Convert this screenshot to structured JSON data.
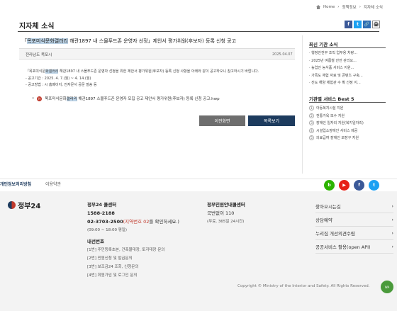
{
  "breadcrumb": [
    "Home",
    "정책정보",
    "지자체 소식"
  ],
  "page_title": "지자체 소식",
  "share_icons": [
    "f",
    "t",
    "🔗",
    "🖨"
  ],
  "post": {
    "title_pre": "「",
    "title_hl1": "목포미식문화갤러리",
    "title_mid": " 해관1897 내 스몰푸드존 운영자 선정」제안서 평가위원(후보자) 등록 신청 공고",
    "author": "전라남도 목포시",
    "date": "2025.04.07",
    "body_line1_pre": "「목포미식문",
    "body_line1_hl": "화갤러리",
    "body_line1_post": " 해관1897 내 스몰푸드존 운영자 선정을 위한 제안서 평가위원(후보자) 등록 신청 사항을 아래와 같이 공고하오니 참고하시기 바랍니다.",
    "body_line2": "- 공고기간 : 2025. 4. 7.(월) ~ 4. 14.(월)",
    "body_line3": "- 공고방법 : 시 홈페이지, 전자문서 공문 발송 등",
    "attachment_pre": "목포미식문화",
    "attachment_hl": "갤러리",
    "attachment_post": " 해관1897 스몰푸드존 운영자 모집 공고 제안서 평가위원(후보자) 등록 신청 공고.hwp"
  },
  "buttons": {
    "prev": "이전화면",
    "list": "목록보기"
  },
  "sidebar": {
    "latest_title": "최신 기관 소식",
    "latest": [
      "· 행정안전부 조직 업무용 차량...",
      "· 2025년 여름철 안전 관리요...",
      "· 농업인 농식품 서비스 지원...",
      "· 가족도 체험 자료 및 콘텐츠 구축...",
      "· 진도 해양 체험관 수 확 선정 지..."
    ],
    "best_title": "기관별 서비스 Best 5",
    "best": [
      "아동복지시설 지원",
      "전통가옥 보수 지원",
      "장애인 일자리 지원(복지일자리)",
      "시설입소장애인 서비스 제공",
      "의료급여 장애인 보장구 지원"
    ]
  },
  "footer": {
    "policy": "개인정보처리방침",
    "terms": "이용약관",
    "sns": [
      {
        "label": "b",
        "color": "#2db400"
      },
      {
        "label": "▶",
        "color": "#e62117"
      },
      {
        "label": "f",
        "color": "#3b5998"
      },
      {
        "label": "t",
        "color": "#1da1f2"
      }
    ],
    "logo_text": "정부24",
    "col1": {
      "title": "정부24 콜센터",
      "phone1": "1588-2188",
      "phone2_pre": "02-3703-2500",
      "phone2_red": "(지역번호 02",
      "phone2_post": "를 확인하세요.)",
      "hours": "(09:00 ~ 18:00 평일)",
      "ext_title": "내선번호",
      "ext1": "[1번] 주민등록초본, 건축물대장, 토지대장 문의",
      "ext2": "[2번] 민원신청 및 발급문의",
      "ext3": "[3번] 보조금24 조회, 신청문의",
      "ext4": "[4번] 회원가입 및 로그인 문의"
    },
    "col2": {
      "title": "정부민원안내콜센터",
      "line1": "국번없이 110",
      "line2": "(무료, 365일 24시간)"
    },
    "links": [
      "찾아오시는길",
      "상담예약",
      "누리집 개선의견수렴",
      "공공서비스 활용(open API)"
    ],
    "copyright": "Copyright © Ministry of the Interior and Safety. All Rights Reserved.",
    "webmark": "WA"
  }
}
